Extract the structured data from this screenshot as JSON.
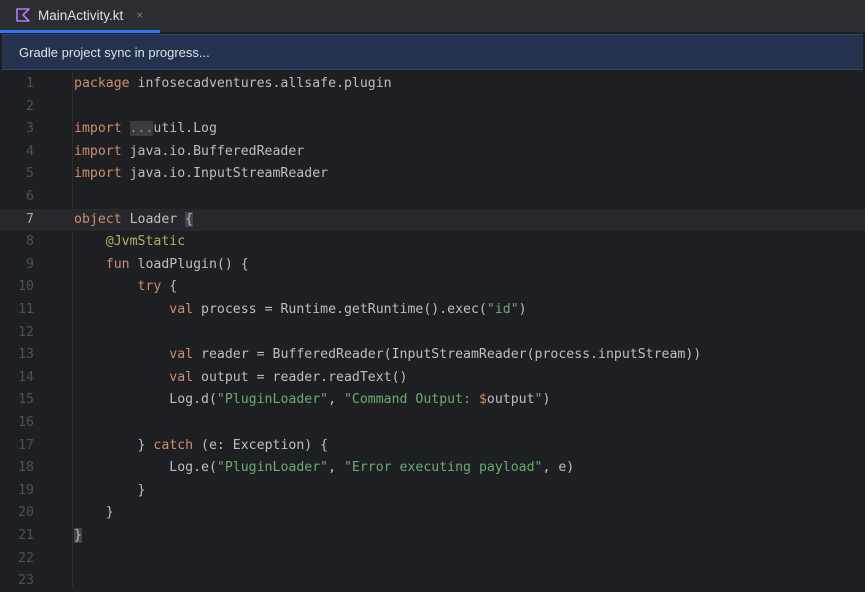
{
  "tab": {
    "label": "MainActivity.kt",
    "close": "×"
  },
  "banner": {
    "text": "Gradle project sync in progress..."
  },
  "editor": {
    "current_line": 7,
    "lines": [
      {
        "n": "1",
        "tokens": [
          {
            "t": "package",
            "c": "kw"
          },
          {
            "t": " infosecadventures.allsafe.plugin",
            "c": ""
          }
        ]
      },
      {
        "n": "2",
        "tokens": []
      },
      {
        "n": "3",
        "tokens": [
          {
            "t": "import",
            "c": "kw"
          },
          {
            "t": " ",
            "c": ""
          },
          {
            "t": "...",
            "c": "dots"
          },
          {
            "t": "util.Log",
            "c": ""
          }
        ]
      },
      {
        "n": "4",
        "tokens": [
          {
            "t": "import",
            "c": "kw"
          },
          {
            "t": " java.io.BufferedReader",
            "c": ""
          }
        ]
      },
      {
        "n": "5",
        "tokens": [
          {
            "t": "import",
            "c": "kw"
          },
          {
            "t": " java.io.InputStreamReader",
            "c": ""
          }
        ]
      },
      {
        "n": "6",
        "tokens": []
      },
      {
        "n": "7",
        "tokens": [
          {
            "t": "object",
            "c": "kw"
          },
          {
            "t": " Loader ",
            "c": ""
          },
          {
            "t": "{",
            "c": "bh"
          }
        ]
      },
      {
        "n": "8",
        "tokens": [
          {
            "t": "    ",
            "c": ""
          },
          {
            "t": "@JvmStatic",
            "c": "ann"
          }
        ]
      },
      {
        "n": "9",
        "tokens": [
          {
            "t": "    ",
            "c": ""
          },
          {
            "t": "fun",
            "c": "kw"
          },
          {
            "t": " loadPlugin() {",
            "c": ""
          }
        ]
      },
      {
        "n": "10",
        "tokens": [
          {
            "t": "        ",
            "c": ""
          },
          {
            "t": "try",
            "c": "kw"
          },
          {
            "t": " {",
            "c": ""
          }
        ]
      },
      {
        "n": "11",
        "tokens": [
          {
            "t": "            ",
            "c": ""
          },
          {
            "t": "val",
            "c": "kw"
          },
          {
            "t": " process = Runtime.getRuntime().exec(",
            "c": ""
          },
          {
            "t": "\"id\"",
            "c": "str"
          },
          {
            "t": ")",
            "c": ""
          }
        ]
      },
      {
        "n": "12",
        "tokens": []
      },
      {
        "n": "13",
        "tokens": [
          {
            "t": "            ",
            "c": ""
          },
          {
            "t": "val",
            "c": "kw"
          },
          {
            "t": " reader = BufferedReader(InputStreamReader(process.inputStream))",
            "c": ""
          }
        ]
      },
      {
        "n": "14",
        "tokens": [
          {
            "t": "            ",
            "c": ""
          },
          {
            "t": "val",
            "c": "kw"
          },
          {
            "t": " output = reader.readText()",
            "c": ""
          }
        ]
      },
      {
        "n": "15",
        "tokens": [
          {
            "t": "            Log.d(",
            "c": ""
          },
          {
            "t": "\"PluginLoader\"",
            "c": "str"
          },
          {
            "t": ", ",
            "c": ""
          },
          {
            "t": "\"Command Output: ",
            "c": "str"
          },
          {
            "t": "$",
            "c": "kw"
          },
          {
            "t": "output",
            "c": ""
          },
          {
            "t": "\"",
            "c": "str"
          },
          {
            "t": ")",
            "c": ""
          }
        ]
      },
      {
        "n": "16",
        "tokens": []
      },
      {
        "n": "17",
        "tokens": [
          {
            "t": "        } ",
            "c": ""
          },
          {
            "t": "catch",
            "c": "kw"
          },
          {
            "t": " (e: Exception) {",
            "c": ""
          }
        ]
      },
      {
        "n": "18",
        "tokens": [
          {
            "t": "            Log.e(",
            "c": ""
          },
          {
            "t": "\"PluginLoader\"",
            "c": "str"
          },
          {
            "t": ", ",
            "c": ""
          },
          {
            "t": "\"Error executing payload\"",
            "c": "str"
          },
          {
            "t": ", e)",
            "c": ""
          }
        ]
      },
      {
        "n": "19",
        "tokens": [
          {
            "t": "        }",
            "c": ""
          }
        ]
      },
      {
        "n": "20",
        "tokens": [
          {
            "t": "    }",
            "c": ""
          }
        ]
      },
      {
        "n": "21",
        "tokens": [
          {
            "t": "}",
            "c": "bh"
          }
        ]
      },
      {
        "n": "22",
        "tokens": []
      },
      {
        "n": "23",
        "tokens": []
      }
    ]
  }
}
